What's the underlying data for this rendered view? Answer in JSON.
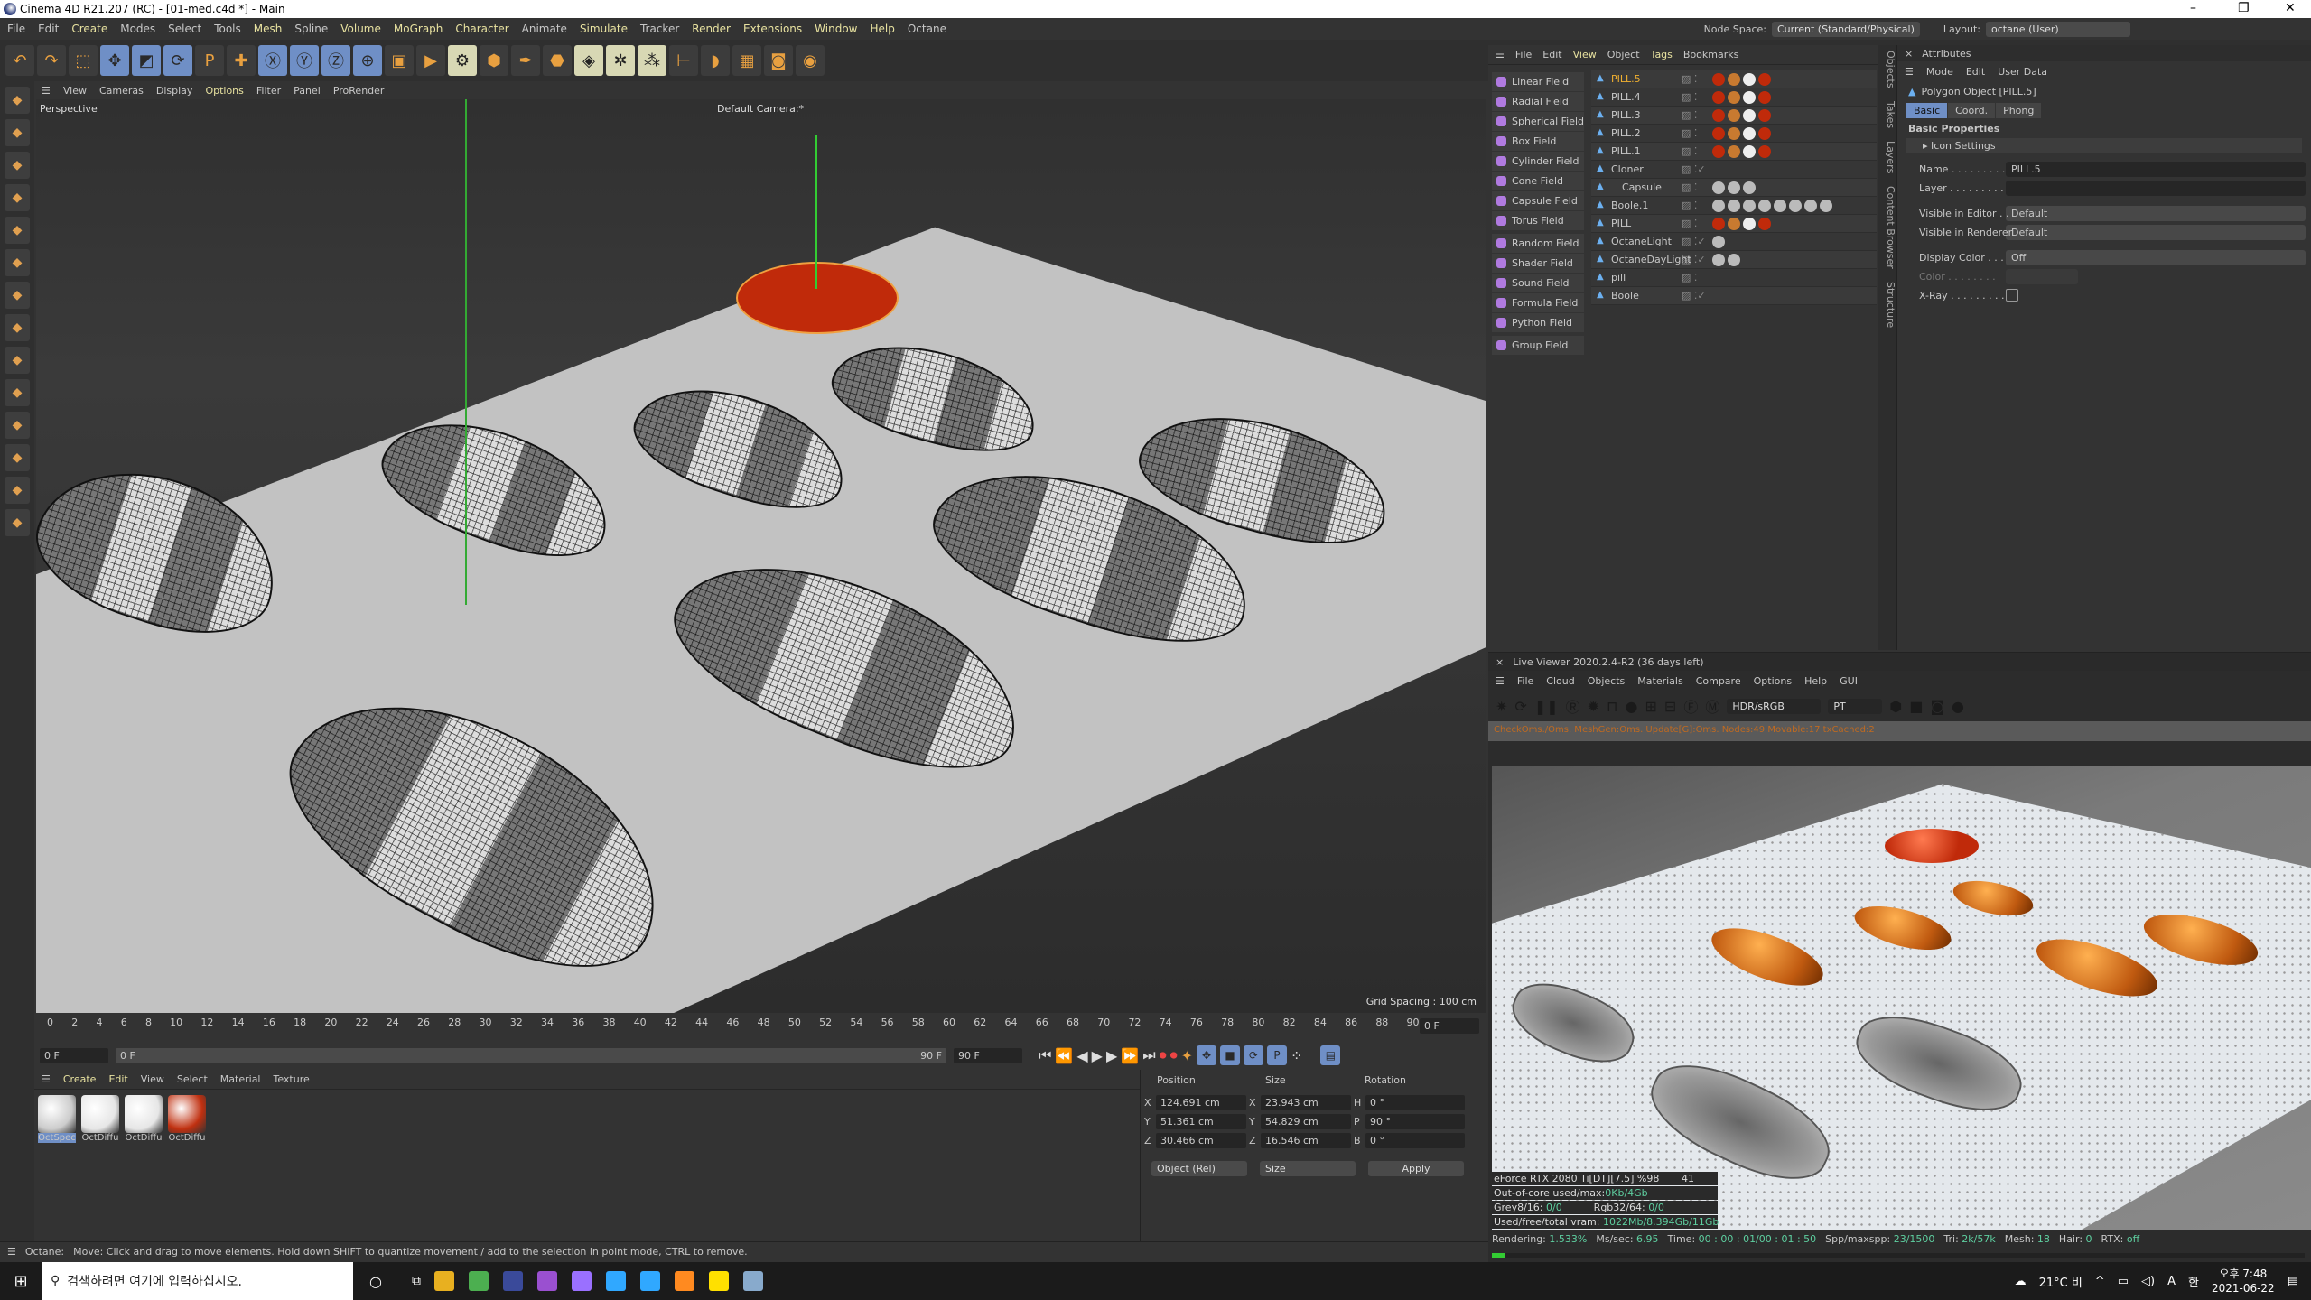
{
  "window": {
    "title": "Cinema 4D R21.207 (RC) - [01-med.c4d *] - Main",
    "controls": [
      "–",
      "❐",
      "✕"
    ]
  },
  "menu": [
    "File",
    "Edit",
    "Create",
    "Modes",
    "Select",
    "Tools",
    "Mesh",
    "Spline",
    "Volume",
    "MoGraph",
    "Character",
    "Animate",
    "Simulate",
    "Tracker",
    "Render",
    "Extensions",
    "Window",
    "Help",
    "Octane"
  ],
  "node_space": {
    "label": "Node Space:",
    "value": "Current (Standard/Physical)"
  },
  "layout": {
    "label": "Layout:",
    "value": "octane (User)"
  },
  "toolbar_icons": [
    "undo-icon",
    "redo-icon",
    "select-icon",
    "move-icon",
    "scale-icon",
    "rotate-icon",
    "psr-icon",
    "add-icon",
    "x-axis-icon",
    "y-axis-icon",
    "z-axis-icon",
    "world-coord-icon",
    "render-view-icon",
    "render-icon",
    "render-settings-icon",
    "cube-icon",
    "pen-icon",
    "subdivision-icon",
    "extrude-icon",
    "cloner-icon",
    "mograph-icon",
    "deformer-icon",
    "field-icon",
    "floor-icon",
    "camera-icon",
    "light-icon"
  ],
  "viewport": {
    "menu": [
      "View",
      "Cameras",
      "Display",
      "Options",
      "Filter",
      "Panel",
      "ProRender"
    ],
    "projection": "Perspective",
    "camera": "Default Camera:*",
    "grid_spacing": "Grid Spacing : 100 cm"
  },
  "timeline": {
    "ticks": [
      "0",
      "2",
      "4",
      "6",
      "8",
      "10",
      "12",
      "14",
      "16",
      "18",
      "20",
      "22",
      "24",
      "26",
      "28",
      "30",
      "32",
      "34",
      "36",
      "38",
      "40",
      "42",
      "44",
      "46",
      "48",
      "50",
      "52",
      "54",
      "56",
      "58",
      "60",
      "62",
      "64",
      "66",
      "68",
      "70",
      "72",
      "74",
      "76",
      "78",
      "80",
      "82",
      "84",
      "86",
      "88",
      "90"
    ],
    "current": "0 F",
    "start": "0 F",
    "range_start": "0 F",
    "range_end": "90 F",
    "end": "90 F"
  },
  "materials": {
    "menu": [
      "Create",
      "Edit",
      "View",
      "Select",
      "Material",
      "Texture"
    ],
    "items": [
      {
        "name": "OctSpec",
        "color": "#cccccc"
      },
      {
        "name": "OctDiffu",
        "color": "#e6e6e6"
      },
      {
        "name": "OctDiffu",
        "color": "#e6e6e6"
      },
      {
        "name": "OctDiffu",
        "color": "#c03010"
      }
    ]
  },
  "coords": {
    "headers": [
      "Position",
      "Size",
      "Rotation"
    ],
    "rows": [
      {
        "a": "X",
        "pos": "124.691 cm",
        "s": "X",
        "size": "23.943 cm",
        "r": "H",
        "rot": "0 °"
      },
      {
        "a": "Y",
        "pos": "51.361 cm",
        "s": "Y",
        "size": "54.829 cm",
        "r": "P",
        "rot": "90 °"
      },
      {
        "a": "Z",
        "pos": "30.466 cm",
        "s": "Z",
        "size": "16.546 cm",
        "r": "B",
        "rot": "0 °"
      }
    ],
    "mode": "Object (Rel)",
    "size_mode": "Size",
    "apply": "Apply"
  },
  "status": {
    "label": "Octane:",
    "message": "Move: Click and drag to move elements. Hold down SHIFT to quantize movement / add to the selection in point mode, CTRL to remove."
  },
  "objects_panel": {
    "menu": [
      "File",
      "Edit",
      "View",
      "Object",
      "Tags",
      "Bookmarks"
    ],
    "fields": [
      "Linear Field",
      "Radial Field",
      "Spherical Field",
      "Box Field",
      "Cylinder Field",
      "Cone Field",
      "Capsule Field",
      "Torus Field",
      "Random Field",
      "Shader Field",
      "Sound Field",
      "Formula Field",
      "Python Field",
      "Group Field"
    ],
    "objects": [
      {
        "name": "PILL.5",
        "selected": true
      },
      {
        "name": "PILL.4"
      },
      {
        "name": "PILL.3"
      },
      {
        "name": "PILL.2"
      },
      {
        "name": "PILL.1"
      },
      {
        "name": "Cloner"
      },
      {
        "name": "Capsule"
      },
      {
        "name": "Boole.1"
      },
      {
        "name": "PILL"
      },
      {
        "name": "OctaneLight"
      },
      {
        "name": "OctaneDayLight"
      },
      {
        "name": "pill"
      },
      {
        "name": "Boole"
      }
    ],
    "side_tabs": [
      "Objects",
      "Takes",
      "Layers",
      "Content Browser",
      "Structure"
    ]
  },
  "attributes": {
    "title": "Attributes",
    "menu": [
      "Mode",
      "Edit",
      "User Data"
    ],
    "object": "Polygon Object [PILL.5]",
    "tabs": [
      "Basic",
      "Coord.",
      "Phong"
    ],
    "section": "Basic Properties",
    "group": "Icon Settings",
    "fields": [
      {
        "label": "Name . . . . . . . . .",
        "value": "PILL.5"
      },
      {
        "label": "Layer . . . . . . . . .",
        "value": ""
      },
      {
        "label": "Visible in Editor . .",
        "value": "Default"
      },
      {
        "label": "Visible in Renderer",
        "value": "Default"
      },
      {
        "label": "Display Color . . .",
        "value": "Off"
      },
      {
        "label": "Color . . . . . . . .",
        "value": ""
      },
      {
        "label": "X-Ray . . . . . . . . .",
        "value": ""
      }
    ]
  },
  "live_viewer": {
    "title": "Live Viewer 2020.2.4-R2 (36 days left)",
    "menu": [
      "File",
      "Cloud",
      "Objects",
      "Materials",
      "Compare",
      "Options",
      "Help",
      "GUI"
    ],
    "color_space": "HDR/sRGB",
    "kernel": "PT",
    "info": "CheckOms./Oms. MeshGen:Oms. Update[G]:Oms. Nodes:49 Movable:17 txCached:2",
    "gpu": "eForce RTX 2080 Ti[DT][7.5] %98",
    "gpu_temp": "41",
    "ooc_label": "Out-of-core used/max:",
    "ooc": "0Kb/4Gb",
    "grey_label": "Grey8/16:",
    "grey": "0/0",
    "rgb_label": "Rgb32/64:",
    "rgb": "0/0",
    "vram_label": "Used/free/total vram:",
    "vram": "1022Mb/8.394Gb/11Gb",
    "stats": [
      {
        "k": "Rendering:",
        "v": "1.533%"
      },
      {
        "k": "Ms/sec:",
        "v": "6.95"
      },
      {
        "k": "Time:",
        "v": "00 : 00 : 01/00 : 01 : 50"
      },
      {
        "k": "Spp/maxspp:",
        "v": "23/1500"
      },
      {
        "k": "Tri:",
        "v": "2k/57k"
      },
      {
        "k": "Mesh:",
        "v": "18"
      },
      {
        "k": "Hair:",
        "v": "0"
      },
      {
        "k": "RTX:",
        "v": "off"
      }
    ],
    "progress": 1.533
  },
  "taskbar": {
    "search_placeholder": "검색하려면 여기에 입력하십시오.",
    "apps": [
      "Explorer",
      "Chrome",
      "Cinema 4D",
      "Premiere",
      "After Effects",
      "Photoshop",
      "Lightroom",
      "Illustrator",
      "KakaoTalk",
      "Notes"
    ],
    "weather": "21°C 비",
    "ime": "A",
    "lang": "한",
    "time": "오후 7:48",
    "date": "2021-06-22"
  }
}
